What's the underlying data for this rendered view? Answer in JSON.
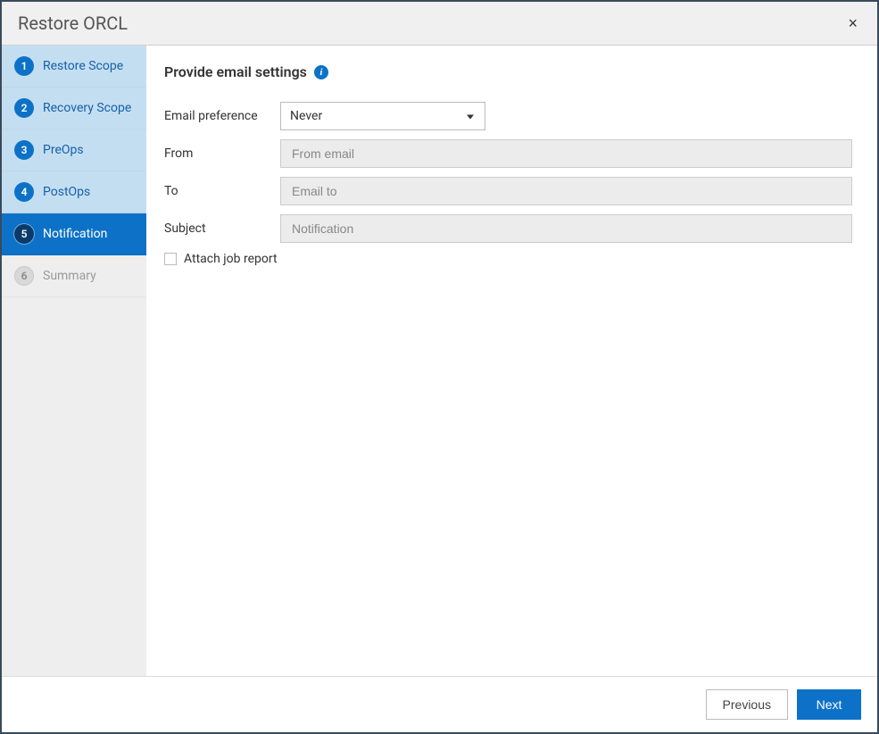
{
  "dialog": {
    "title": "Restore ORCL",
    "close_symbol": "×"
  },
  "sidebar": {
    "steps": [
      {
        "num": "1",
        "label": "Restore Scope",
        "state": "completed"
      },
      {
        "num": "2",
        "label": "Recovery Scope",
        "state": "completed"
      },
      {
        "num": "3",
        "label": "PreOps",
        "state": "completed"
      },
      {
        "num": "4",
        "label": "PostOps",
        "state": "completed"
      },
      {
        "num": "5",
        "label": "Notification",
        "state": "active"
      },
      {
        "num": "6",
        "label": "Summary",
        "state": "pending"
      }
    ]
  },
  "main": {
    "section_title": "Provide email settings",
    "info_icon_glyph": "i",
    "fields": {
      "email_pref_label": "Email preference",
      "email_pref_value": "Never",
      "from_label": "From",
      "from_placeholder": "From email",
      "to_label": "To",
      "to_placeholder": "Email to",
      "subject_label": "Subject",
      "subject_placeholder": "Notification",
      "attach_label": "Attach job report",
      "attach_checked": false
    }
  },
  "footer": {
    "previous_label": "Previous",
    "next_label": "Next"
  }
}
